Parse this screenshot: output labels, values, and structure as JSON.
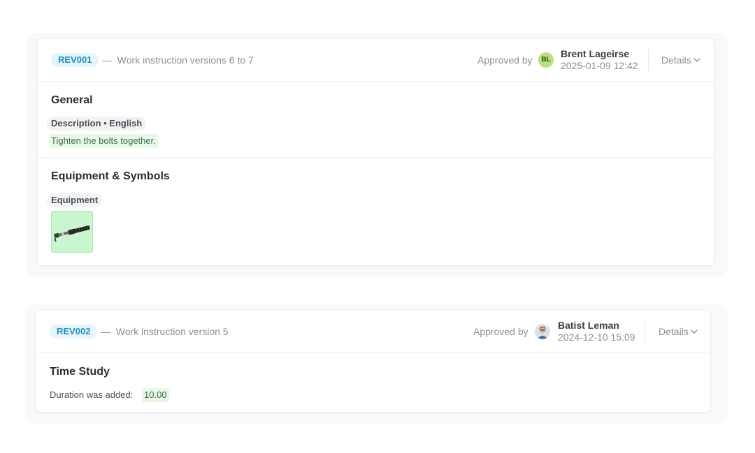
{
  "revisions": [
    {
      "id": "REV001",
      "separator": "—",
      "description": "Work instruction versions 6 to 7",
      "approved_by_label": "Approved by",
      "approver": {
        "initials": "BL",
        "name": "Brent Lageirse",
        "date": "2025-01-09 12:42",
        "avatar_color": "#b9e07f"
      },
      "details_label": "Details",
      "sections": {
        "general": {
          "title": "General",
          "field_chip": "Description • English",
          "added_value": "Tighten the bolts together."
        },
        "equipment": {
          "title": "Equipment & Symbols",
          "field_chip": "Equipment",
          "thumbnail_icon": "torque-wrench-icon"
        }
      }
    },
    {
      "id": "REV002",
      "separator": "—",
      "description": "Work instruction version 5",
      "approved_by_label": "Approved by",
      "approver": {
        "name": "Batist Leman",
        "date": "2024-12-10 15:09",
        "avatar_icon": "user-photo-icon"
      },
      "details_label": "Details",
      "sections": {
        "time_study": {
          "title": "Time Study",
          "change_text": "Duration was added:",
          "added_value": "10.00"
        }
      }
    }
  ],
  "colors": {
    "badge_bg": "#e6f4fb",
    "badge_text": "#1a8fc4",
    "added_bg": "#e8f9ea",
    "added_text": "#3d6b46"
  }
}
